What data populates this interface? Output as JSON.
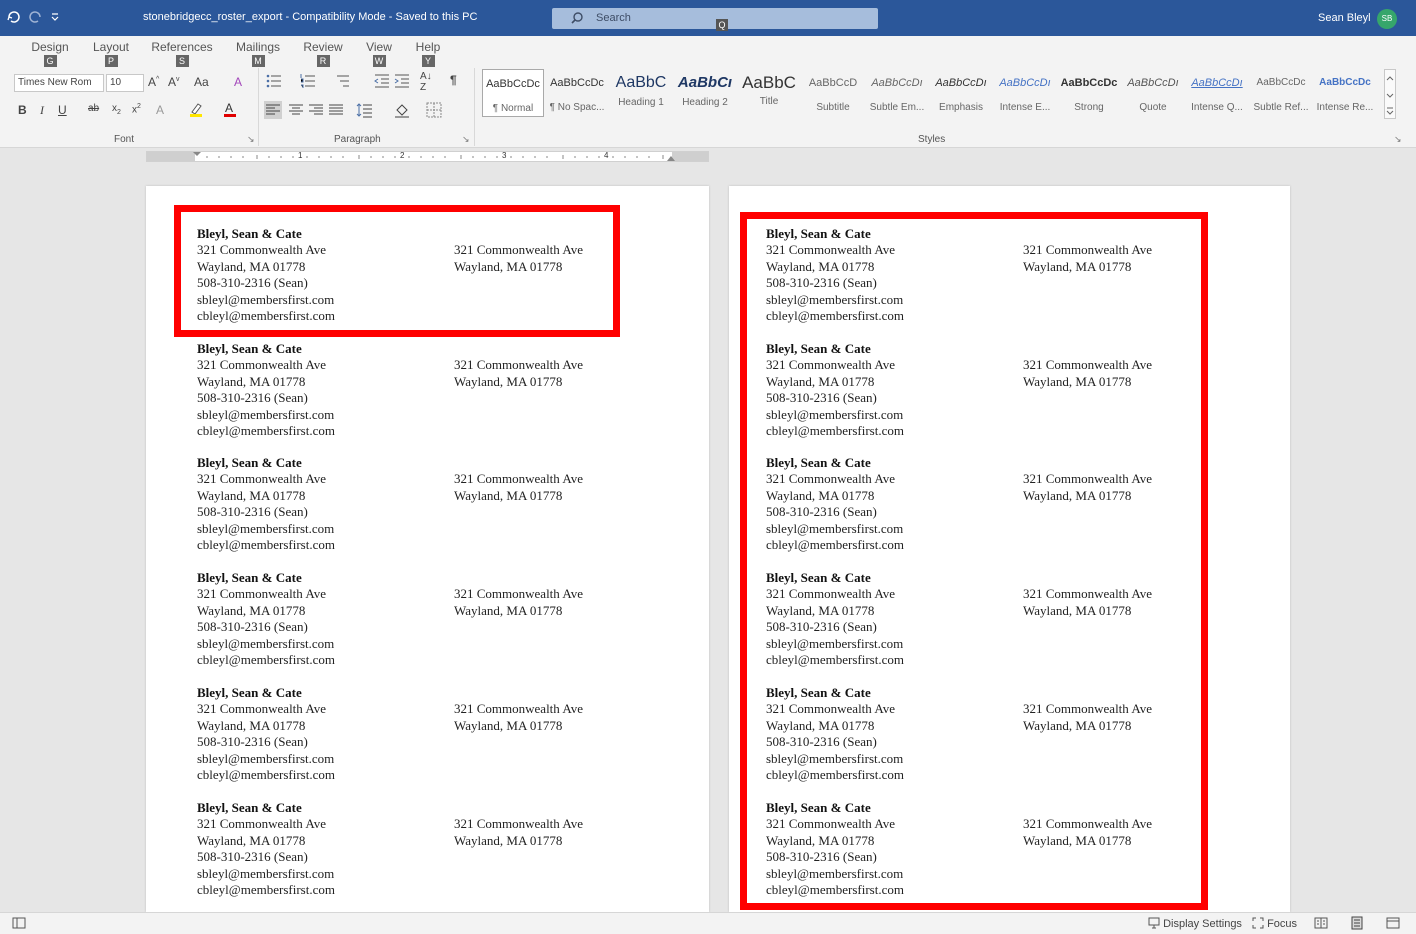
{
  "titlebar": {
    "document_title": "stonebridgecc_roster_export  -  Compatibility Mode  -  Saved to this PC",
    "search_placeholder": "Search",
    "search_keytip": "Q",
    "user_name": "Sean Bleyl",
    "user_initials": "SB"
  },
  "ribbon": {
    "tabs": [
      {
        "label": "Design",
        "key": "G"
      },
      {
        "label": "Layout",
        "key": "P"
      },
      {
        "label": "References",
        "key": "S"
      },
      {
        "label": "Mailings",
        "key": "M"
      },
      {
        "label": "Review",
        "key": "R"
      },
      {
        "label": "View",
        "key": "W"
      },
      {
        "label": "Help",
        "key": "Y"
      }
    ],
    "font_name": "Times New Rom",
    "font_size": "10",
    "groups": {
      "font": "Font",
      "paragraph": "Paragraph",
      "styles": "Styles"
    },
    "styles": [
      {
        "preview": "AaBbCcDc",
        "name": "¶ Normal"
      },
      {
        "preview": "AaBbCcDc",
        "name": "¶ No Spac..."
      },
      {
        "preview": "AaBbC",
        "name": "Heading 1"
      },
      {
        "preview": "AaBbCı",
        "name": "Heading 2"
      },
      {
        "preview": "AaBbC",
        "name": "Title"
      },
      {
        "preview": "AaBbCcD",
        "name": "Subtitle"
      },
      {
        "preview": "AaBbCcDı",
        "name": "Subtle Em..."
      },
      {
        "preview": "AaBbCcDı",
        "name": "Emphasis"
      },
      {
        "preview": "AaBbCcDı",
        "name": "Intense E..."
      },
      {
        "preview": "AaBbCcDc",
        "name": "Strong"
      },
      {
        "preview": "AaBbCcDı",
        "name": "Quote"
      },
      {
        "preview": "AaBbCcDı",
        "name": "Intense Q..."
      },
      {
        "preview": "AaBbCcDc",
        "name": "Subtle Ref..."
      },
      {
        "preview": "AaBbCcDc",
        "name": "Intense Re..."
      }
    ]
  },
  "ruler": {
    "numbers": [
      "1",
      "2",
      "3",
      "4"
    ]
  },
  "label": {
    "name": "Bleyl, Sean & Cate",
    "street": "321 Commonwealth Ave",
    "city": "Wayland, MA 01778",
    "phone": "508-310-2316 (Sean)",
    "email1": "sbleyl@membersfirst.com",
    "email2": "cbleyl@membersfirst.com"
  },
  "statusbar": {
    "display_settings": "Display Settings",
    "focus": "Focus"
  },
  "colors": {
    "titlebar": "#2b579a",
    "highlight": "#ff0000",
    "avatar": "#36a66b"
  }
}
